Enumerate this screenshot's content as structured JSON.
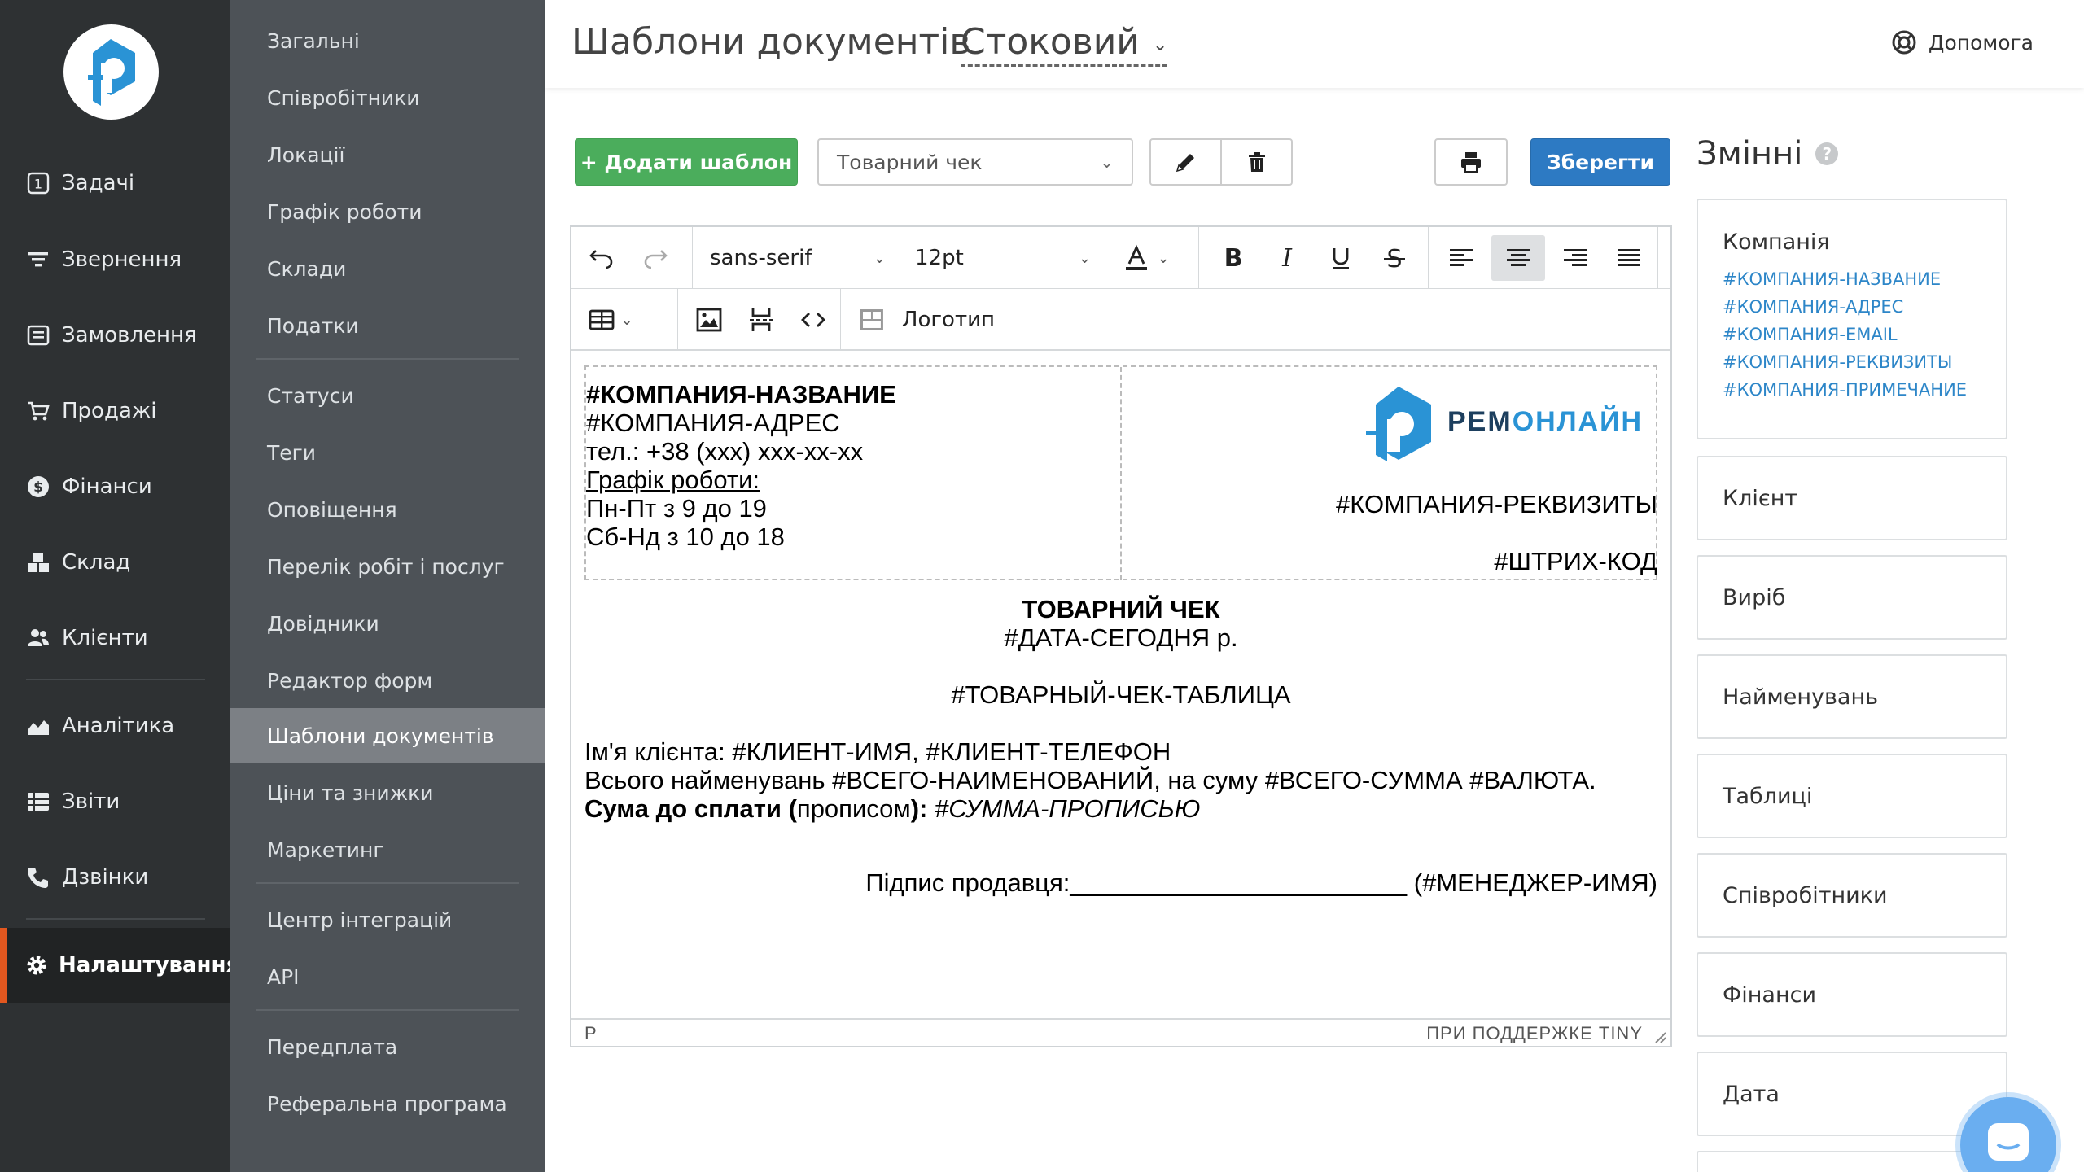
{
  "header": {
    "title": "Шаблони документів",
    "theme": "Стоковий",
    "help": "Допомога"
  },
  "nav": {
    "items": [
      {
        "label": "Задачі",
        "icon": "task-one-icon",
        "badge": "1"
      },
      {
        "label": "Звернення",
        "icon": "funnel-icon"
      },
      {
        "label": "Замовлення",
        "icon": "order-icon"
      },
      {
        "label": "Продажі",
        "icon": "cart-icon"
      },
      {
        "label": "Фінанси",
        "icon": "dollar-icon"
      },
      {
        "label": "Склад",
        "icon": "boxes-icon"
      },
      {
        "label": "Клієнти",
        "icon": "users-icon"
      },
      {
        "label": "Аналітика",
        "icon": "area-chart-icon"
      },
      {
        "label": "Звіти",
        "icon": "report-list-icon"
      },
      {
        "label": "Дзвінки",
        "icon": "phone-icon"
      },
      {
        "label": "Налаштування",
        "icon": "gear-icon",
        "active": true
      }
    ]
  },
  "submenu": {
    "items": [
      "Загальні",
      "Співробітники",
      "Локації",
      "Графік роботи",
      "Склади",
      "Податки",
      "Статуси",
      "Теги",
      "Оповіщення",
      "Перелік робіт і послуг",
      "Довідники",
      "Редактор форм",
      "Шаблони документів",
      "Ціни та знижки",
      "Маркетинг",
      "Центр інтеграцій",
      "API",
      "Передплата",
      "Реферальна програма"
    ],
    "active": "Шаблони документів"
  },
  "toolbar": {
    "add_label": "+ Додати шаблон",
    "template_value": "Товарний чек",
    "save_label": "Зберегти"
  },
  "editor": {
    "font_family": "sans-serif",
    "font_size": "12pt",
    "logo_label": "Логотип",
    "status_path": "P",
    "powered_by": "ПРИ ПОДДЕРЖКЕ TINY"
  },
  "document": {
    "company_name": "#КОМПАНИЯ-НАЗВАНИЕ",
    "company_address": "#КОМПАНИЯ-АДРЕС",
    "phone": "тел.: +38 (ххх) ххх-хх-хх",
    "schedule_title": "Графік роботи:",
    "schedule_weekdays": "Пн-Пт з 9 до 19",
    "schedule_weekend": "Сб-Нд з 10 до 18",
    "logo_text_a": "РЕМ",
    "logo_text_b": "ОНЛАЙН",
    "requisites": "#КОМПАНИЯ-РЕКВИЗИТЫ",
    "barcode": "#ШТРИХ-КОД",
    "doc_title": "ТОВАРНИЙ ЧЕК",
    "doc_date": "#ДАТА-СЕГОДНЯ р.",
    "doc_table": "#ТОВАРНЫЙ-ЧЕК-ТАБЛИЦА",
    "client_line": "Ім'я клієнта: #КЛИЕНТ-ИМЯ, #КЛИЕНТ-ТЕЛЕФОН",
    "total_line": "Всього найменувань #ВСЕГО-НАИМЕНОВАНИЙ, на суму #ВСЕГО-СУММА #ВАЛЮТА.",
    "sum_label": "Сума до сплати",
    "sum_paren_open": " (",
    "sum_words": "прописом",
    "sum_paren_close": "):",
    "sum_var": " #СУММА-ПРОПИСЬЮ",
    "signature_label": "Підпис продавця:",
    "signature_line": "________________________",
    "manager": " (#МЕНЕДЖЕР-ИМЯ)"
  },
  "variables": {
    "title": "Змінні",
    "help_mark": "?",
    "groups": [
      {
        "title": "Компанія",
        "items": [
          "#КОМПАНИЯ-НАЗВАНИЕ",
          "#КОМПАНИЯ-АДРЕС",
          "#КОМПАНИЯ-EMAIL",
          "#КОМПАНИЯ-РЕКВИЗИТЫ",
          "#КОМПАНИЯ-ПРИМЕЧАНИЕ"
        ]
      },
      {
        "title": "Клієнт"
      },
      {
        "title": "Виріб"
      },
      {
        "title": "Найменувань"
      },
      {
        "title": "Таблиці"
      },
      {
        "title": "Співробітники"
      },
      {
        "title": "Фінанси"
      },
      {
        "title": "Дата"
      }
    ]
  },
  "colors": {
    "sidebar": "#2e3133",
    "submenu": "#4d5257",
    "active_accent": "#e2571f",
    "add_button": "#4bad5c",
    "save_button": "#2d7ac3",
    "variable_link": "#2d86c8",
    "brand_blue": "#2a93d5"
  }
}
